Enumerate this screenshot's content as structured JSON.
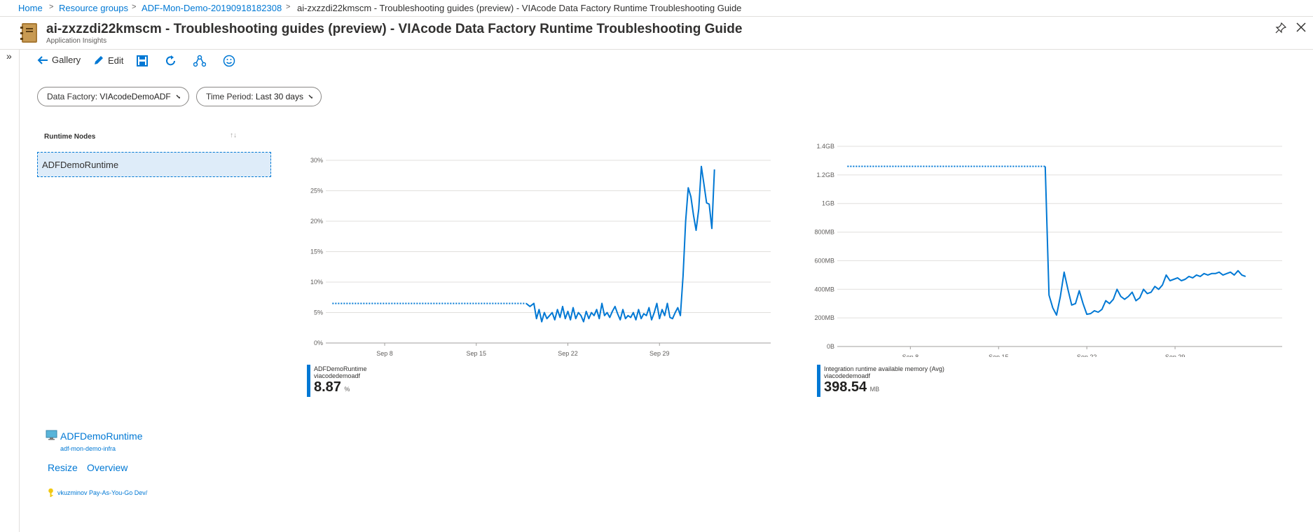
{
  "breadcrumb": {
    "items": [
      "Home",
      "Resource groups",
      "ADF-Mon-Demo-20190918182308"
    ],
    "current": "ai-zxzzdi22kmscm - Troubleshooting guides (preview) - VIAcode Data Factory Runtime Troubleshooting Guide"
  },
  "header": {
    "title": "ai-zxzzdi22kmscm - Troubleshooting guides (preview) - VIAcode Data Factory Runtime Troubleshooting Guide",
    "subtitle": "Application Insights",
    "icons": [
      "workbook-icon",
      "pin-icon",
      "close-icon"
    ]
  },
  "rail": {
    "expand_icon": "»"
  },
  "toolbar": {
    "gallery_label": "Gallery",
    "edit_label": "Edit",
    "icons": [
      "back-arrow-icon",
      "pencil-icon",
      "save-icon",
      "refresh-icon",
      "share-icon",
      "smiley-icon"
    ]
  },
  "params": {
    "data_factory_label": "Data Factory:",
    "data_factory_value": "VIAcodeDemoADF",
    "time_period_label": "Time Period:",
    "time_period_value": "Last 30 days"
  },
  "grid": {
    "header": "Runtime Nodes",
    "rows": [
      "ADFDemoRuntime"
    ]
  },
  "chart_cpu_legend": {
    "name": "ADFDemoRuntime",
    "sub": "viacodedemoadf",
    "value": "8.87",
    "unit": "%"
  },
  "chart_mem_legend": {
    "name": "Integration runtime available memory (Avg)",
    "sub": "viacodedemoadf",
    "value": "398.54",
    "unit": "MB"
  },
  "resource": {
    "name": "ADFDemoRuntime",
    "group": "adf-mon-demo-infra",
    "resize": "Resize",
    "overview": "Overview",
    "subscription": "vkuzminov Pay-As-You-Go Dev/"
  },
  "colors": {
    "accent": "#0078d4",
    "selected_row": "#deecf9"
  },
  "chart_data": [
    {
      "type": "line",
      "y_ticks": [
        "0%",
        "5%",
        "10%",
        "15%",
        "20%",
        "25%",
        "30%"
      ],
      "ylim": [
        0,
        30
      ],
      "x_ticks": [
        "Sep 8",
        "Sep 15",
        "Sep 22",
        "Sep 29"
      ],
      "x_tick_days": [
        8,
        15,
        22,
        29
      ],
      "xlim_days": [
        3.5,
        37.5
      ],
      "grid": true,
      "series": [
        {
          "name": "ADFDemoRuntime",
          "dotted": [
            [
              4,
              6.5
            ],
            [
              18.8,
              6.5
            ]
          ],
          "days": [
            18.8,
            19.1,
            19.4,
            19.6,
            19.8,
            20.0,
            20.2,
            20.4,
            20.6,
            20.8,
            21.0,
            21.2,
            21.4,
            21.6,
            21.8,
            22.0,
            22.2,
            22.4,
            22.6,
            22.8,
            23.0,
            23.2,
            23.4,
            23.6,
            23.8,
            24.0,
            24.2,
            24.4,
            24.6,
            24.8,
            25.0,
            25.2,
            25.4,
            25.6,
            25.8,
            26.0,
            26.2,
            26.4,
            26.6,
            26.8,
            27.0,
            27.2,
            27.4,
            27.6,
            27.8,
            28.0,
            28.2,
            28.4,
            28.6,
            28.8,
            29.0,
            29.2,
            29.4,
            29.6,
            29.8,
            30.0,
            30.2,
            30.4,
            30.6,
            30.8,
            31.0,
            31.2,
            31.4,
            31.6,
            31.8,
            32.0,
            32.2,
            32.4,
            32.6,
            32.8,
            33.0,
            33.2,
            33.4,
            33.6,
            33.8,
            34.0,
            34.2,
            34.4,
            34.6,
            34.8,
            35.0,
            35.2,
            35.4,
            35.6,
            35.8,
            36.0
          ],
          "values": [
            6.5,
            6.0,
            6.5,
            4.0,
            5.5,
            3.5,
            5.0,
            4.0,
            4.5,
            5.0,
            3.8,
            5.5,
            4.2,
            6.0,
            4.0,
            5.2,
            3.8,
            5.8,
            4.0,
            5.0,
            4.5,
            3.5,
            5.2,
            4.0,
            5.0,
            4.5,
            5.5,
            4.0,
            6.5,
            4.5,
            5.0,
            4.2,
            5.2,
            6.0,
            4.8,
            3.8,
            5.5,
            4.0,
            4.5,
            4.2,
            5.0,
            3.8,
            5.5,
            4.0,
            4.8,
            4.5,
            5.8,
            3.8,
            5.0,
            6.5,
            4.0,
            5.5,
            4.5,
            6.5,
            4.2,
            4.0,
            5.0,
            5.8,
            4.5,
            11.0,
            20.0,
            25.5,
            24.0,
            21.0,
            18.5,
            22.0,
            29.0,
            26.0,
            23.0,
            22.8,
            18.8,
            28.5
          ]
        }
      ]
    },
    {
      "type": "line",
      "y_ticks": [
        "0B",
        "200MB",
        "400MB",
        "600MB",
        "800MB",
        "1GB",
        "1.2GB",
        "1.4GB"
      ],
      "ylim": [
        0,
        1400
      ],
      "x_ticks": [
        "Sep 8",
        "Sep 15",
        "Sep 22",
        "Sep 29"
      ],
      "x_tick_days": [
        8,
        15,
        22,
        29
      ],
      "xlim_days": [
        2.2,
        37.5
      ],
      "grid": true,
      "series": [
        {
          "name": "Integration runtime available memory (Avg)",
          "dotted": [
            [
              3,
              1260
            ],
            [
              18.7,
              1260
            ]
          ],
          "days": [
            18.7,
            19.0,
            19.3,
            19.6,
            19.9,
            20.2,
            20.5,
            20.8,
            21.1,
            21.4,
            21.7,
            22.0,
            22.3,
            22.6,
            22.9,
            23.2,
            23.5,
            23.8,
            24.1,
            24.4,
            24.7,
            25.0,
            25.3,
            25.6,
            25.9,
            26.2,
            26.5,
            26.8,
            27.1,
            27.4,
            27.7,
            28.0,
            28.3,
            28.6,
            28.9,
            29.2,
            29.5,
            29.8,
            30.1,
            30.4,
            30.7,
            31.0,
            31.3,
            31.6,
            31.9,
            32.2,
            32.5,
            32.8,
            33.1,
            33.4,
            33.7,
            34.0,
            34.3,
            34.6
          ],
          "values": [
            1260,
            360,
            270,
            220,
            350,
            520,
            400,
            290,
            300,
            390,
            300,
            225,
            230,
            250,
            240,
            260,
            320,
            300,
            330,
            400,
            350,
            330,
            350,
            380,
            320,
            340,
            400,
            370,
            380,
            420,
            400,
            430,
            500,
            460,
            470,
            480,
            460,
            470,
            490,
            480,
            500,
            490,
            510,
            500,
            510,
            510,
            520,
            500,
            510,
            520,
            500,
            530,
            500,
            490
          ]
        }
      ]
    }
  ]
}
